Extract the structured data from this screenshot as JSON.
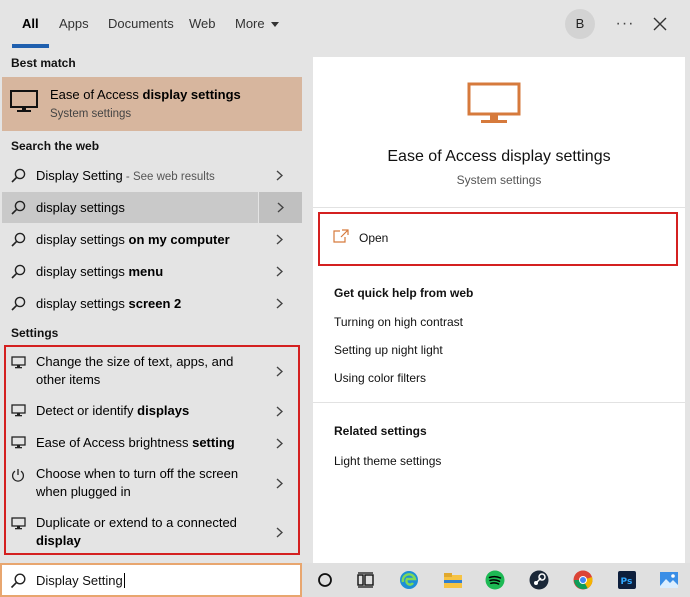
{
  "tabs": [
    {
      "label": "All",
      "active": true
    },
    {
      "label": "Apps"
    },
    {
      "label": "Documents"
    },
    {
      "label": "Web"
    },
    {
      "label": "More"
    }
  ],
  "account": {
    "initial": "B"
  },
  "header_icons": {
    "more": "ellipsis-icon",
    "close": "close-icon"
  },
  "best_match": {
    "heading": "Best match",
    "title_plain": "Ease of Access ",
    "title_bold": "display settings",
    "subtitle": "System settings",
    "icon": "monitor-icon"
  },
  "search_web": {
    "heading": "Search the web",
    "items": [
      {
        "plain": "Display Setting",
        "bold": "",
        "suffix": " - See web results"
      },
      {
        "plain": "display settings",
        "bold": "",
        "suffix": ""
      },
      {
        "plain": "display settings ",
        "bold": "on my computer",
        "suffix": ""
      },
      {
        "plain": "display settings ",
        "bold": "menu",
        "suffix": ""
      },
      {
        "plain": "display settings ",
        "bold": "screen 2",
        "suffix": ""
      }
    ]
  },
  "settings": {
    "heading": "Settings",
    "items": [
      {
        "line1": "Change the size of text, apps, and",
        "line2": "other items",
        "icon": "monitor-icon"
      },
      {
        "plain": "Detect or identify ",
        "bold": "displays",
        "icon": "monitor-icon"
      },
      {
        "plain": "Ease of Access brightness ",
        "bold": "setting",
        "icon": "monitor-icon"
      },
      {
        "line1": "Choose when to turn off the screen",
        "line2": "when plugged in",
        "icon": "power-icon"
      },
      {
        "line1": "Duplicate or extend to a connected",
        "line2_bold": "display",
        "icon": "monitor-icon"
      }
    ]
  },
  "preview": {
    "title": "Ease of Access display settings",
    "subtitle": "System settings",
    "open_label": "Open",
    "quick_help_heading": "Get quick help from web",
    "quick_help_links": [
      "Turning on high contrast",
      "Setting up night light",
      "Using color filters"
    ],
    "related_heading": "Related settings",
    "related_links": [
      "Light theme settings"
    ]
  },
  "search": {
    "value": "Display Setting"
  },
  "colors": {
    "accent": "#1f5fae",
    "best_match_bg": "#d7b69e",
    "highlight_border": "#d42020",
    "search_border": "#e8a66f",
    "monitor_icon": "#d67a3c"
  },
  "taskbar_icons": [
    "cortana-icon",
    "task-view-icon",
    "edge-icon",
    "file-explorer-icon",
    "spotify-icon",
    "steam-icon",
    "chrome-icon",
    "photoshop-icon",
    "photos-icon"
  ]
}
